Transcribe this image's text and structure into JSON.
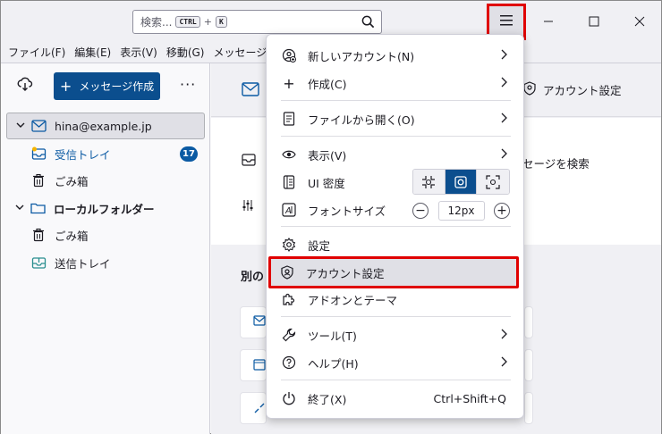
{
  "search": {
    "placeholder": "検索...",
    "key1": "CTRL",
    "plus": "+",
    "key2": "K"
  },
  "menubar": [
    "ファイル(F)",
    "編集(E)",
    "表示(V)",
    "移動(G)",
    "メッセージ(M"
  ],
  "sidebar": {
    "compose_label": "メッセージ作成",
    "account": "hina@example.jp",
    "inbox": "受信トレイ",
    "inbox_count": "17",
    "trash1": "ごみ箱",
    "local": "ローカルフォルダー",
    "trash2": "ごみ箱",
    "outbox": "送信トレイ"
  },
  "main": {
    "account_settings": "アカウント設定",
    "search_messages": "セージを検索",
    "other_label": "別の"
  },
  "popup": {
    "new_account": "新しいアカウント(N)",
    "create": "作成(C)",
    "open_file": "ファイルから開く(O)",
    "view": "表示(V)",
    "ui_density": "UI 密度",
    "font_size": "フォントサイズ",
    "font_size_value": "12px",
    "settings": "設定",
    "account_settings": "アカウント設定",
    "addons": "アドオンとテーマ",
    "tools": "ツール(T)",
    "help": "ヘルプ(H)",
    "quit": "終了(X)",
    "quit_accel": "Ctrl+Shift+Q"
  },
  "colors": {
    "accent": "#0b4e8e",
    "highlight_border": "#e00000"
  }
}
